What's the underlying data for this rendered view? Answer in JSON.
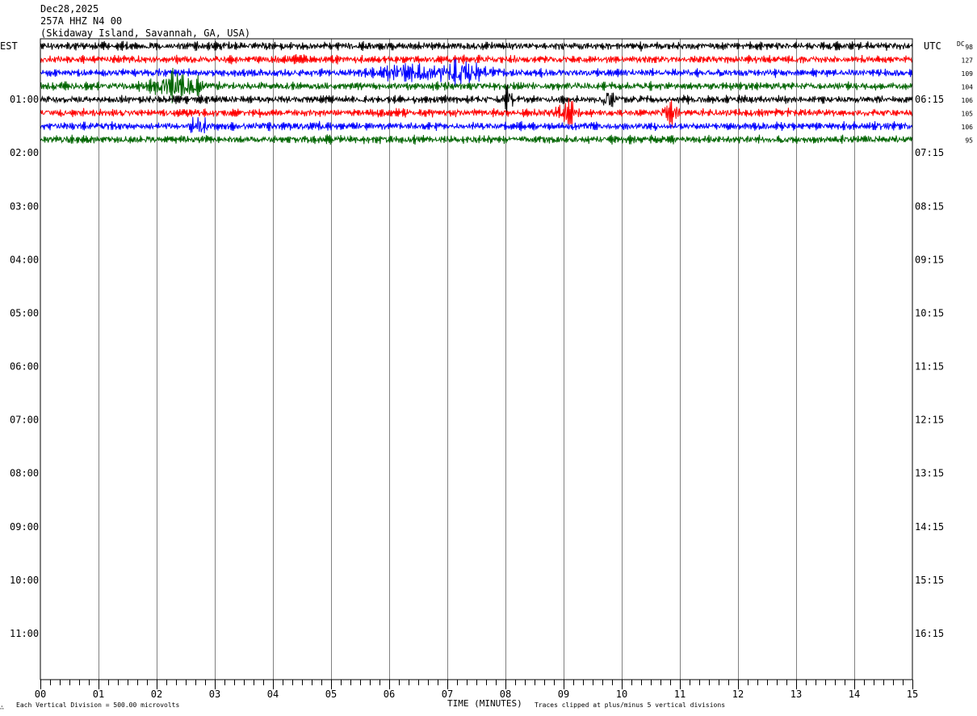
{
  "header": {
    "date": "Dec28,2025",
    "station": "257A HHZ N4 00",
    "location": "(Skidaway Island, Savannah, GA, USA)"
  },
  "left_axis_title": "EST",
  "right_axis_title": "UTC",
  "dc_title": "DC",
  "footer": {
    "logo": "∴",
    "division_note": "Each Vertical Division =  500.00 microvolts",
    "xlabel": "TIME (MINUTES)",
    "clip_note": "Traces clipped at plus/minus 5 vertical divisions"
  },
  "colors": {
    "cycle": [
      "#000000",
      "#ff0000",
      "#0000ff",
      "#006400"
    ],
    "grid": "#808080",
    "frame": "#000000"
  },
  "chart_data": {
    "type": "line",
    "title": "",
    "xlabel": "TIME (MINUTES)",
    "ylabel": "",
    "xlim": [
      0,
      15
    ],
    "x_ticks": [
      "00",
      "01",
      "02",
      "03",
      "04",
      "05",
      "06",
      "07",
      "08",
      "09",
      "10",
      "11",
      "12",
      "13",
      "14",
      "15"
    ],
    "row_count": 48,
    "rows_per_hour": 4,
    "left_hour_labels": [
      {
        "row": 4,
        "label": "01:00"
      },
      {
        "row": 8,
        "label": "02:00"
      },
      {
        "row": 12,
        "label": "03:00"
      },
      {
        "row": 16,
        "label": "04:00"
      },
      {
        "row": 20,
        "label": "05:00"
      },
      {
        "row": 24,
        "label": "06:00"
      },
      {
        "row": 28,
        "label": "07:00"
      },
      {
        "row": 32,
        "label": "08:00"
      },
      {
        "row": 36,
        "label": "09:00"
      },
      {
        "row": 40,
        "label": "10:00"
      },
      {
        "row": 44,
        "label": "11:00"
      }
    ],
    "right_hour_labels": [
      {
        "row": 4,
        "label": "06:15"
      },
      {
        "row": 8,
        "label": "07:15"
      },
      {
        "row": 12,
        "label": "08:15"
      },
      {
        "row": 16,
        "label": "09:15"
      },
      {
        "row": 20,
        "label": "10:15"
      },
      {
        "row": 24,
        "label": "11:15"
      },
      {
        "row": 28,
        "label": "12:15"
      },
      {
        "row": 32,
        "label": "13:15"
      },
      {
        "row": 36,
        "label": "14:15"
      },
      {
        "row": 40,
        "label": "15:15"
      },
      {
        "row": 44,
        "label": "16:15"
      }
    ],
    "series": [
      {
        "row": 0,
        "color": "#000000",
        "dc": "98",
        "bursts": []
      },
      {
        "row": 1,
        "color": "#ff0000",
        "dc": "127",
        "bursts": []
      },
      {
        "row": 2,
        "color": "#0000ff",
        "dc": "109",
        "bursts": [
          {
            "t": 6.4,
            "w": 0.6,
            "a": 1.7
          },
          {
            "t": 7.3,
            "w": 0.35,
            "a": 2.6
          }
        ]
      },
      {
        "row": 3,
        "color": "#006400",
        "dc": "104",
        "bursts": [
          {
            "t": 2.3,
            "w": 0.35,
            "a": 2.8
          },
          {
            "t": 2.6,
            "w": 0.12,
            "a": 1.5
          }
        ]
      },
      {
        "row": 4,
        "color": "#000000",
        "dc": "106",
        "bursts": [
          {
            "t": 8.05,
            "w": 0.08,
            "a": 2.2
          },
          {
            "t": 9.75,
            "w": 0.09,
            "a": 2.4
          }
        ]
      },
      {
        "row": 5,
        "color": "#ff0000",
        "dc": "105",
        "bursts": [
          {
            "t": 9.05,
            "w": 0.18,
            "a": 2.8
          },
          {
            "t": 10.85,
            "w": 0.12,
            "a": 2.2
          }
        ]
      },
      {
        "row": 6,
        "color": "#0000ff",
        "dc": "106",
        "bursts": [
          {
            "t": 2.7,
            "w": 0.2,
            "a": 1.6
          }
        ]
      },
      {
        "row": 7,
        "color": "#006400",
        "dc": "95",
        "bursts": []
      }
    ]
  }
}
